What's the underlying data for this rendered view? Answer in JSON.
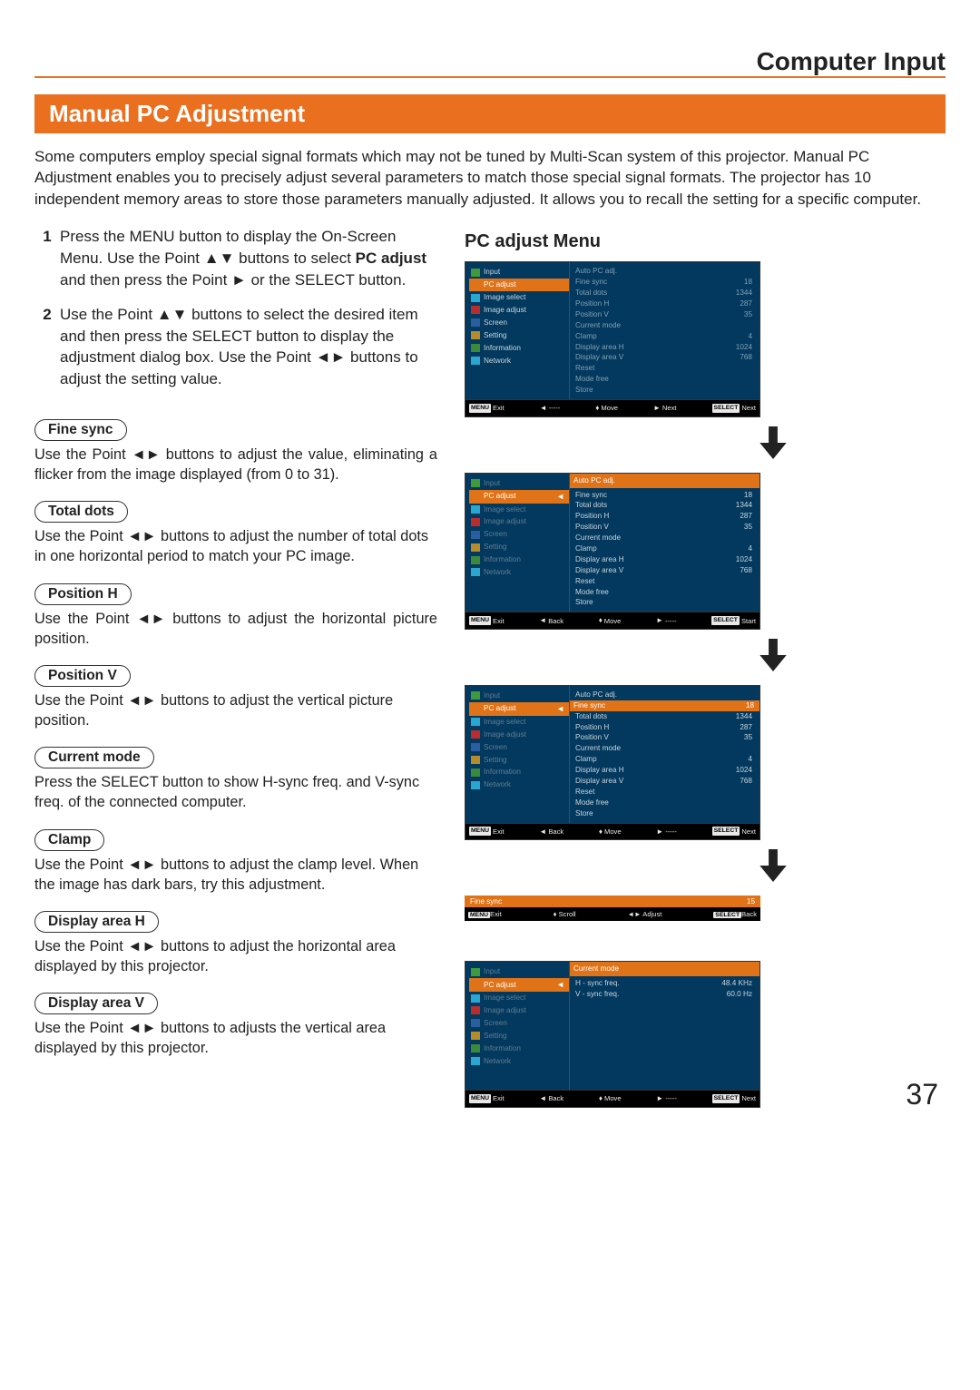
{
  "header": {
    "title": "Computer Input"
  },
  "section_title": "Manual PC Adjustment",
  "intro": "Some computers employ special signal formats which may not be tuned by Multi-Scan system of this projector. Manual PC Adjustment enables you to precisely adjust several parameters to match those special signal formats. The projector has 10 independent memory areas to store those parameters manually adjusted. It allows you to recall the setting for a specific computer.",
  "steps": [
    {
      "num": "1",
      "lines": [
        "Press the MENU button to display the On-Screen Menu. Use the Point ▲▼ buttons to select ",
        "PC adjust",
        " and then press the Point ► or the SELECT button."
      ]
    },
    {
      "num": "2",
      "text": "Use the Point ▲▼ buttons to select the desired item and then press the SELECT button to display the adjustment dialog box. Use the Point ◄► buttons to adjust the setting value."
    }
  ],
  "items": [
    {
      "pill": "Fine sync",
      "desc": "Use the Point ◄► buttons to adjust the value, eliminating a flicker from the image displayed (from 0 to 31).",
      "justify": true
    },
    {
      "pill": "Total dots",
      "desc": "Use the Point ◄► buttons to adjust the number of total dots in one horizontal period to match your PC image."
    },
    {
      "pill": "Position H",
      "desc": "Use the Point ◄► buttons to adjust the horizontal picture position.",
      "justify": true
    },
    {
      "pill": "Position V",
      "desc": "Use the Point ◄► buttons to adjust the vertical picture position."
    },
    {
      "pill": "Current mode",
      "desc": "Press the SELECT button to show H-sync freq. and V-sync freq. of  the connected computer."
    },
    {
      "pill": "Clamp",
      "desc": "Use the Point ◄► buttons to adjust the clamp level. When the image has dark bars, try this adjustment."
    },
    {
      "pill": "Display area H",
      "desc": "Use the Point ◄► buttons to adjust the horizontal area displayed by this projector."
    },
    {
      "pill": "Display area V",
      "desc": "Use the Point ◄► buttons to adjusts the vertical area displayed by this projector."
    }
  ],
  "right": {
    "title": "PC adjust Menu"
  },
  "osd": {
    "side_items": [
      {
        "ic": "ic-in",
        "label": "Input"
      },
      {
        "ic": "ic-pc",
        "label": "PC adjust"
      },
      {
        "ic": "ic-is",
        "label": "Image select"
      },
      {
        "ic": "ic-ia",
        "label": "Image adjust"
      },
      {
        "ic": "ic-sc",
        "label": "Screen"
      },
      {
        "ic": "ic-se",
        "label": "Setting"
      },
      {
        "ic": "ic-if",
        "label": "Information"
      },
      {
        "ic": "ic-nw",
        "label": "Network"
      }
    ],
    "rows": [
      {
        "l": "Auto PC adj.",
        "r": ""
      },
      {
        "l": "Fine sync",
        "r": "18"
      },
      {
        "l": "Total dots",
        "r": "1344"
      },
      {
        "l": "Position H",
        "r": "287"
      },
      {
        "l": "Position V",
        "r": "35"
      },
      {
        "l": "Current mode",
        "r": ""
      },
      {
        "l": "Clamp",
        "r": "4"
      },
      {
        "l": "Display area H",
        "r": "1024"
      },
      {
        "l": "Display area V",
        "r": "768"
      },
      {
        "l": "Reset",
        "r": ""
      },
      {
        "l": "Mode free",
        "r": ""
      },
      {
        "l": "Store",
        "r": ""
      }
    ],
    "foot1": {
      "exit": "Exit",
      "back": "-----",
      "move": "Move",
      "next": "Next",
      "sel": "Next",
      "back_lbl": "Back",
      "start": "Start"
    },
    "slim": {
      "label": "Fine sync",
      "val": "15",
      "exit": "Exit",
      "scroll": "Scroll",
      "adjust": "Adjust",
      "back": "Back"
    },
    "panel5_hdr": "Current mode",
    "panel5_rows": [
      {
        "l": "H - sync freq.",
        "r": "48.4 KHz"
      },
      {
        "l": "V - sync freq.",
        "r": "60.0 Hz"
      }
    ]
  },
  "page_number": "37",
  "glyph": {
    "menu": "MENU",
    "select": "SELECT",
    "left": "◄",
    "right": "►",
    "updown": "▲▼",
    "lr": "◄►",
    "ud": "↕"
  }
}
